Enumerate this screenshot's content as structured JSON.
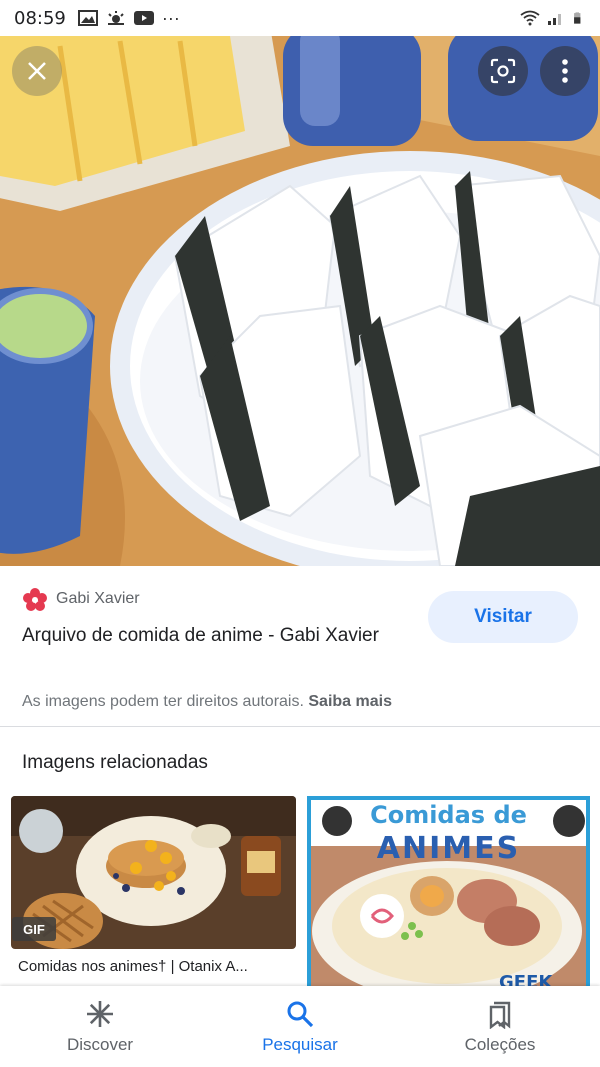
{
  "status_bar": {
    "time": "08:59",
    "overflow": "···"
  },
  "hero": {
    "close_icon": "close-icon",
    "lens_icon": "lens-icon",
    "more_icon": "more-vert-icon"
  },
  "result": {
    "source_name": "Gabi Xavier",
    "title": "Arquivo de comida de anime - Gabi Xavier",
    "visit_label": "Visitar",
    "copyright_text": "As imagens podem ter direitos autorais.",
    "learn_more": "Saiba mais"
  },
  "related": {
    "heading": "Imagens relacionadas",
    "items": [
      {
        "badge": "GIF",
        "caption": "Comidas nos animes† | Otanix A..."
      },
      {
        "overlay_title_line1": "Comidas de",
        "overlay_title_line2": "ANIMES",
        "corner_text": "GEEK"
      }
    ]
  },
  "bottom_nav": {
    "items": [
      {
        "label": "Discover",
        "icon": "asterisk-icon"
      },
      {
        "label": "Pesquisar",
        "icon": "search-icon"
      },
      {
        "label": "Coleções",
        "icon": "collections-icon"
      }
    ]
  },
  "colors": {
    "accent": "#1a73e8",
    "visit_bg": "#e8f0fe",
    "source_logo": "#e53950"
  }
}
